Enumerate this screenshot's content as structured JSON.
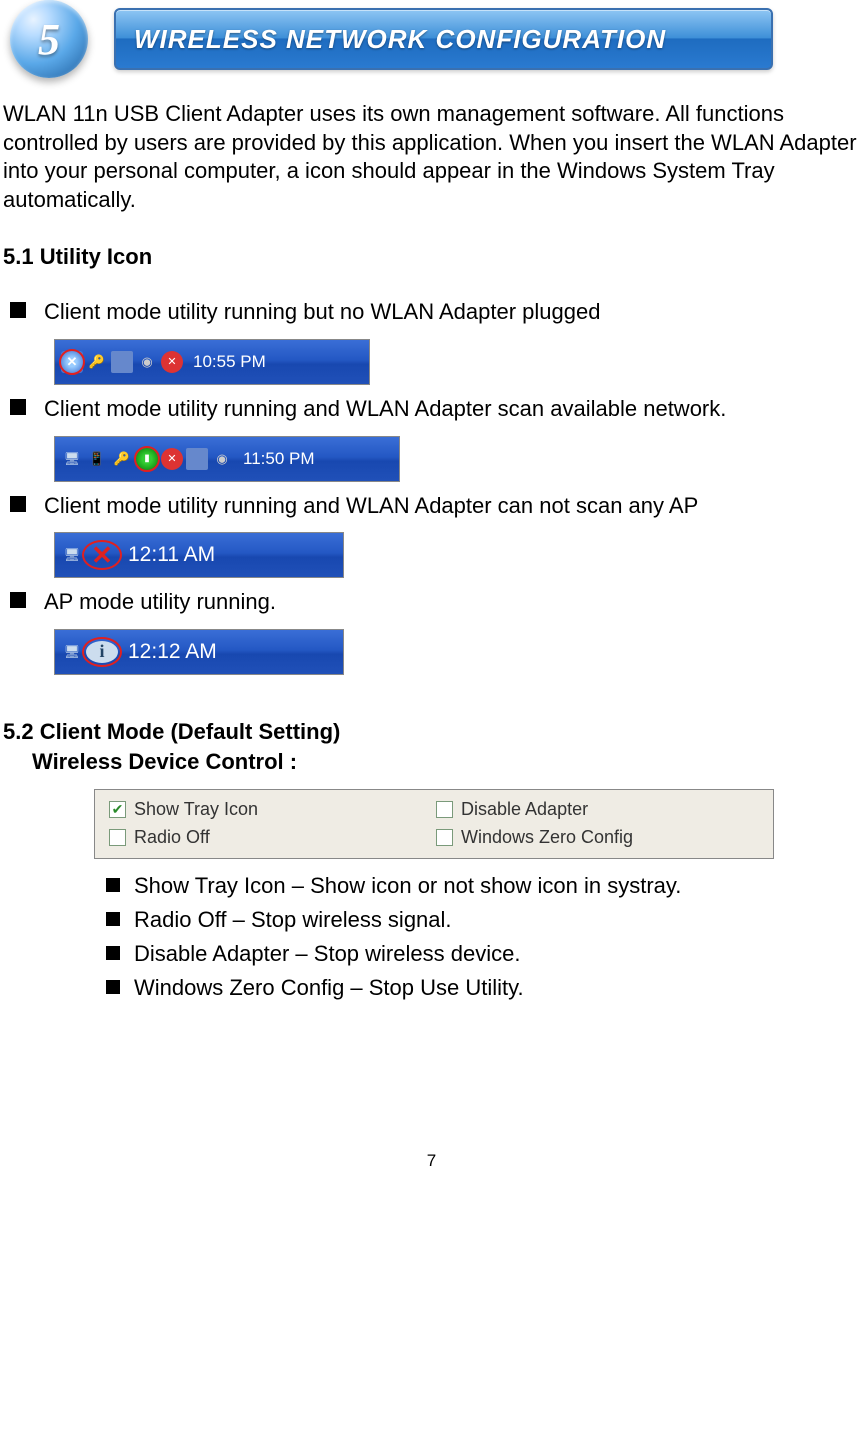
{
  "header": {
    "number": "5",
    "title": "WIRELESS NETWORK CONFIGURATION"
  },
  "intro": "WLAN 11n USB Client Adapter uses its own management software. All functions controlled by users are provided by this application. When you insert the WLAN Adapter into your personal computer, a icon should appear in the Windows System Tray automatically.",
  "section51": {
    "heading": "5.1 Utility Icon",
    "items": [
      {
        "text": "Client mode utility running but no WLAN Adapter plugged",
        "time": "10:55 PM"
      },
      {
        "text": "Client mode utility running and WLAN Adapter scan available network.",
        "time": "11:50 PM"
      },
      {
        "text": "Client mode utility running and WLAN Adapter can not scan any AP",
        "time": "12:11 AM"
      },
      {
        "text": "AP mode utility running.",
        "time": "12:12 AM"
      }
    ]
  },
  "section52": {
    "heading": "5.2 Client Mode (Default Setting)",
    "subheading": "Wireless Device Control :",
    "controls": {
      "show_tray_icon": {
        "label": "Show Tray Icon",
        "checked": true
      },
      "radio_off": {
        "label": "Radio Off",
        "checked": false
      },
      "disable_adapter": {
        "label": "Disable Adapter",
        "checked": false
      },
      "windows_zero_config": {
        "label": "Windows Zero Config",
        "checked": false
      }
    },
    "descriptions": [
      "Show Tray Icon – Show icon or not show icon in systray.",
      "Radio Off – Stop wireless signal.",
      "Disable Adapter – Stop wireless device.",
      " Windows Zero Config – Stop Use Utility."
    ]
  },
  "page_number": "7"
}
